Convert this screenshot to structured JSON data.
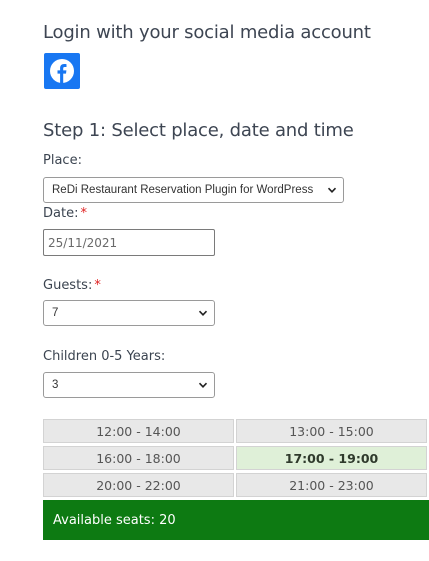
{
  "social": {
    "title": "Login with your social media account",
    "facebook_icon": "facebook-icon",
    "facebook_color": "#1877f2"
  },
  "step1": {
    "title": "Step 1: Select place, date and time",
    "place_label": "Place:",
    "place_value": "ReDi Restaurant Reservation Plugin for WordPress",
    "date_label": "Date:",
    "date_required": "*",
    "date_value": "25/11/2021",
    "guests_label": "Guests:",
    "guests_required": "*",
    "guests_value": "7",
    "children_label": "Children 0-5 Years:",
    "children_value": "3"
  },
  "time_slots": [
    {
      "label": "12:00 - 14:00",
      "selected": false
    },
    {
      "label": "13:00 - 15:00",
      "selected": false
    },
    {
      "label": "16:00 - 18:00",
      "selected": false
    },
    {
      "label": "17:00 - 19:00",
      "selected": true
    },
    {
      "label": "20:00 - 22:00",
      "selected": false
    },
    {
      "label": "21:00 - 23:00",
      "selected": false
    }
  ],
  "availability": {
    "text": "Available seats: 20",
    "color": "#0d7a12"
  },
  "colors": {
    "selected_slot": "#dff0d8",
    "required": "#e02020"
  }
}
